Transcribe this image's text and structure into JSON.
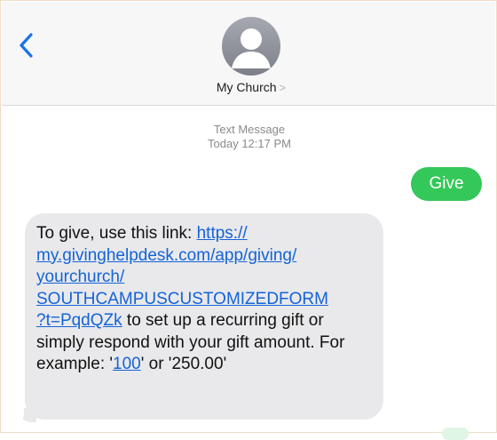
{
  "header": {
    "back_icon": "chevron-left-icon",
    "avatar_icon": "person-silhouette-icon",
    "contact_name": "My Church",
    "contact_chevron": ">"
  },
  "thread": {
    "message_type": "Text Message",
    "timestamp": "Today 12:17 PM"
  },
  "messages": {
    "outgoing": {
      "text": "Give",
      "color": "#34c759"
    },
    "incoming": {
      "intro": "To give, use this link: ",
      "link_lines": [
        "https://",
        "my.givinghelpdesk.com/app/giving/",
        "yourchurch/",
        "SOUTHCAMPUSCUSTOMIZEDFORM",
        "?t=PqdQZk"
      ],
      "after_link": " to set up a recurring gift or simply respond with your gift amount. For example: '",
      "example_1": "100",
      "between": "' or '",
      "example_2": "250.00",
      "end": "'",
      "link_color": "#1463d8",
      "bubble_color": "#e9e9eb"
    }
  }
}
